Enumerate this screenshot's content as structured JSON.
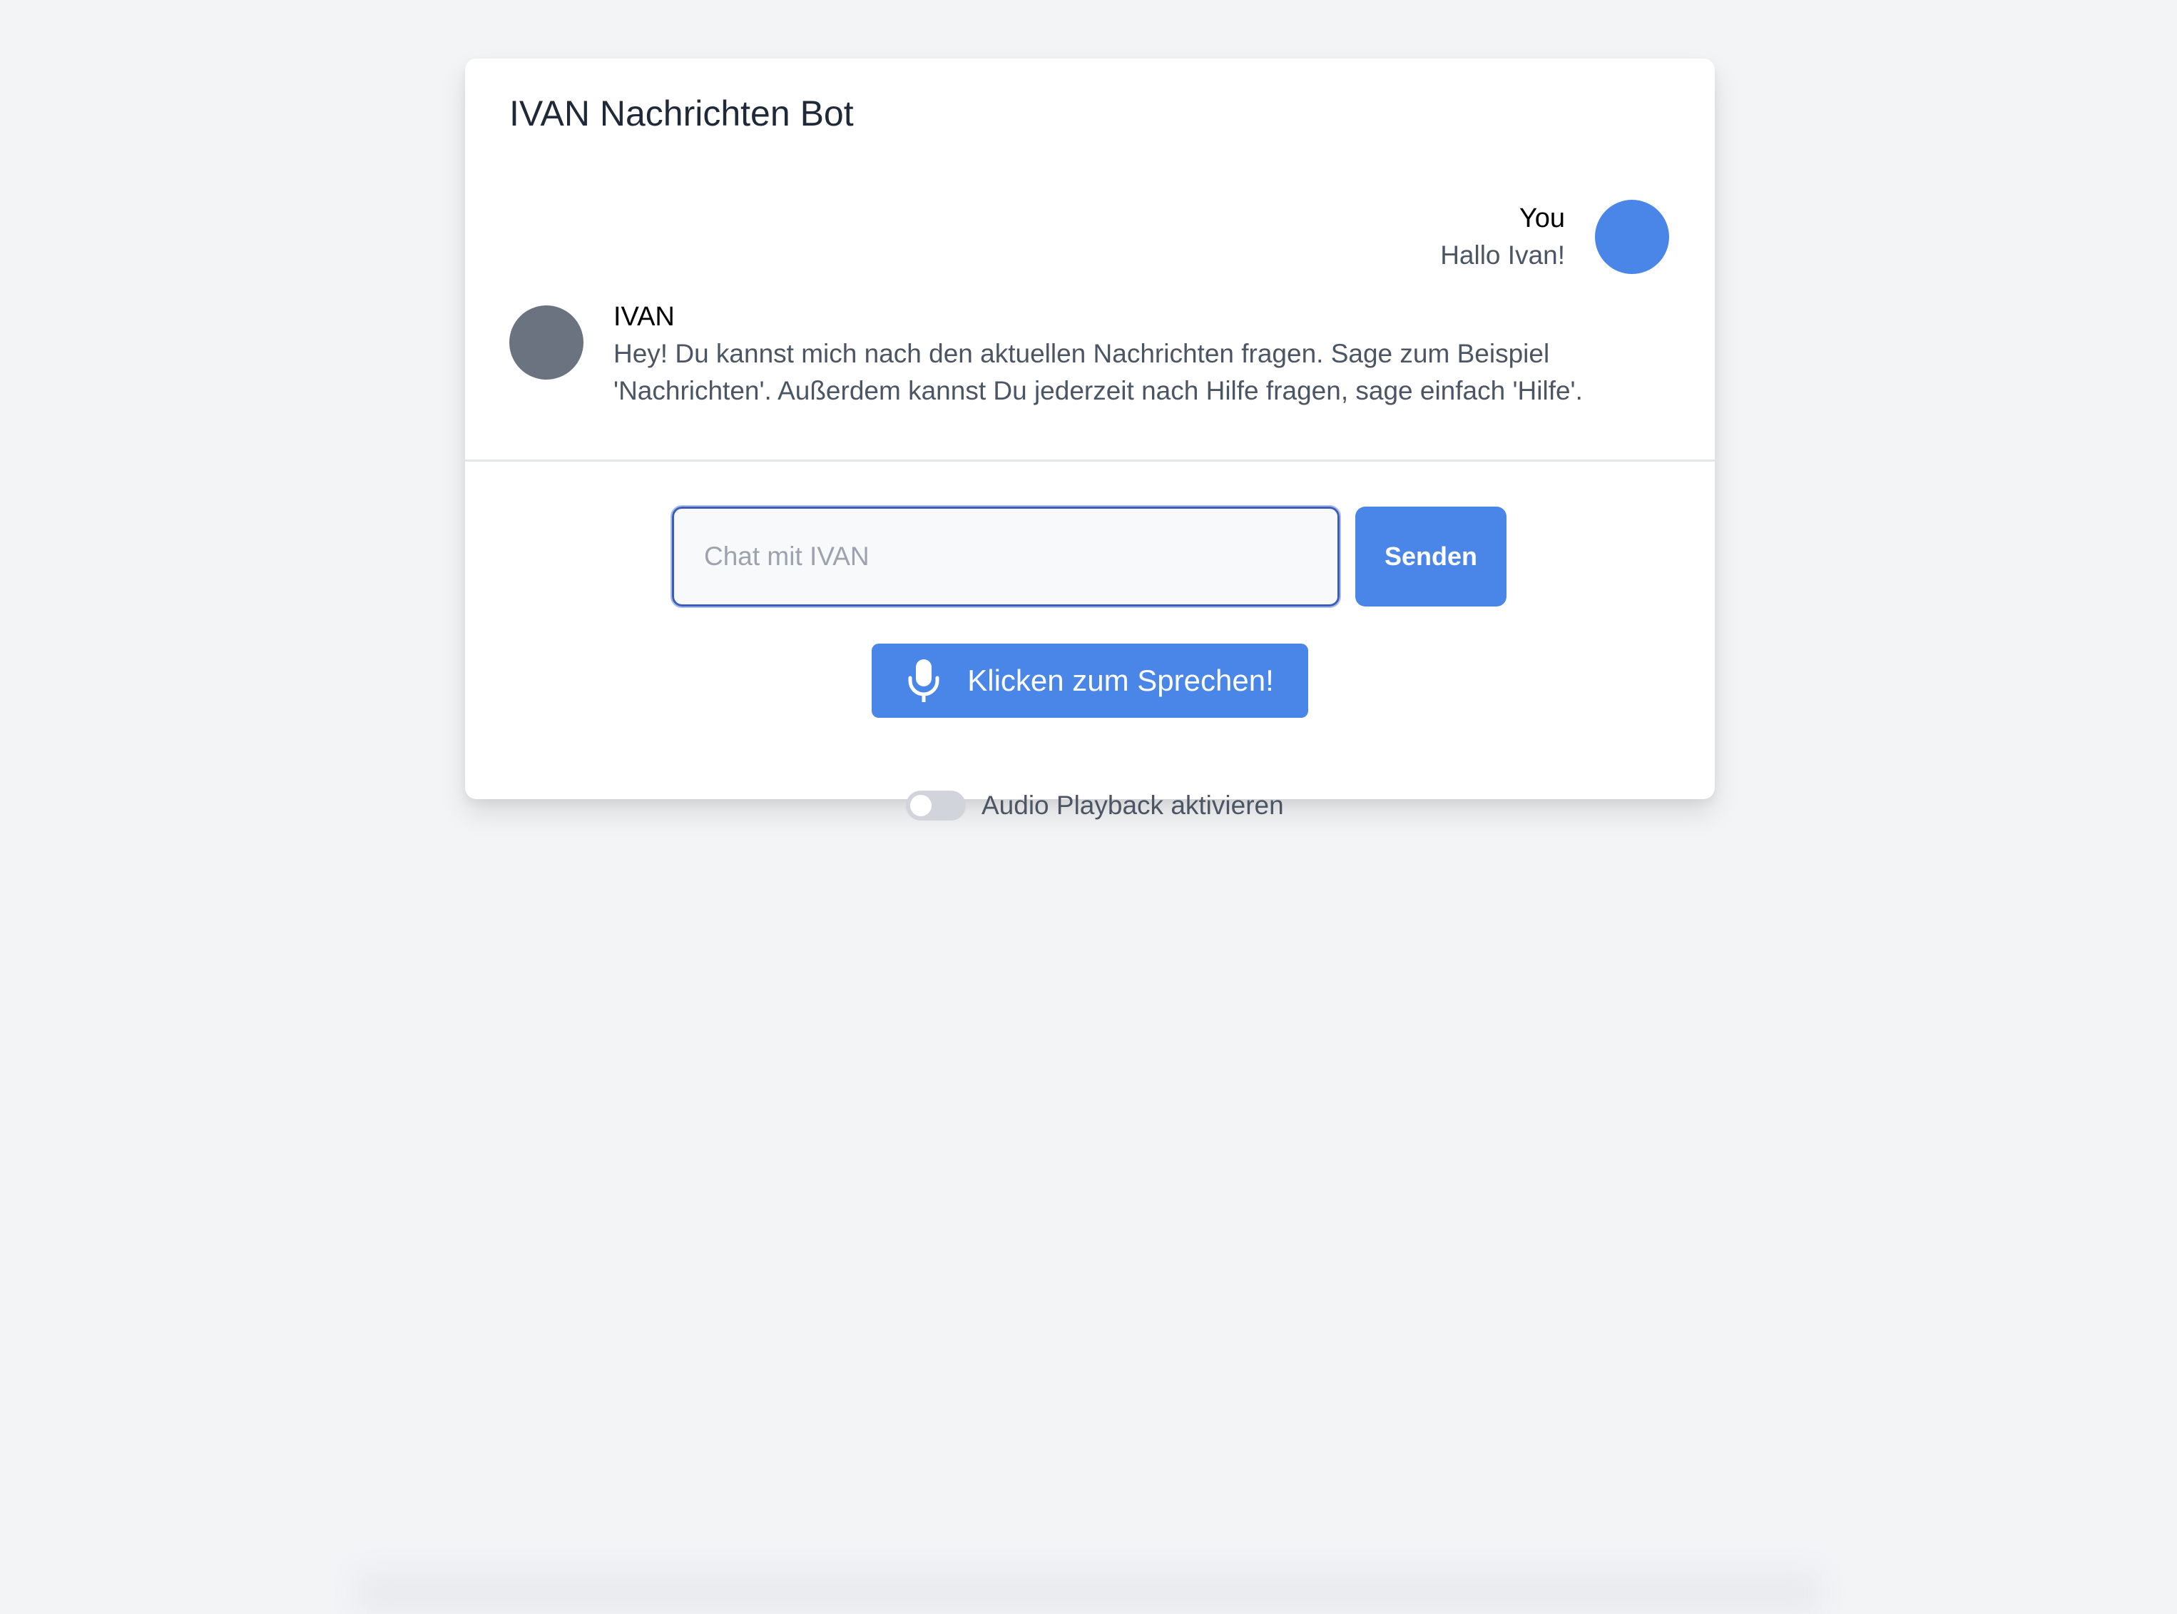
{
  "app": {
    "title": "IVAN Nachrichten Bot"
  },
  "messages": [
    {
      "sender": "You",
      "text": "Hallo Ivan!"
    },
    {
      "sender": "IVAN",
      "text": "Hey! Du kannst mich nach den aktuellen Nachrichten fragen. Sage zum Beispiel 'Nachrichten'. Außerdem kannst Du jederzeit nach Hilfe fragen, sage einfach 'Hilfe'."
    }
  ],
  "input": {
    "placeholder": "Chat mit IVAN",
    "value": ""
  },
  "buttons": {
    "send_label": "Senden",
    "speak_label": "Klicken zum Sprechen!"
  },
  "toggle": {
    "label": "Audio Playback aktivieren",
    "enabled": false
  },
  "colors": {
    "accent": "#4a86e8",
    "bot_avatar": "#6b7280",
    "background": "#f3f4f6"
  },
  "icons": {
    "speak_button": "microphone-icon"
  }
}
